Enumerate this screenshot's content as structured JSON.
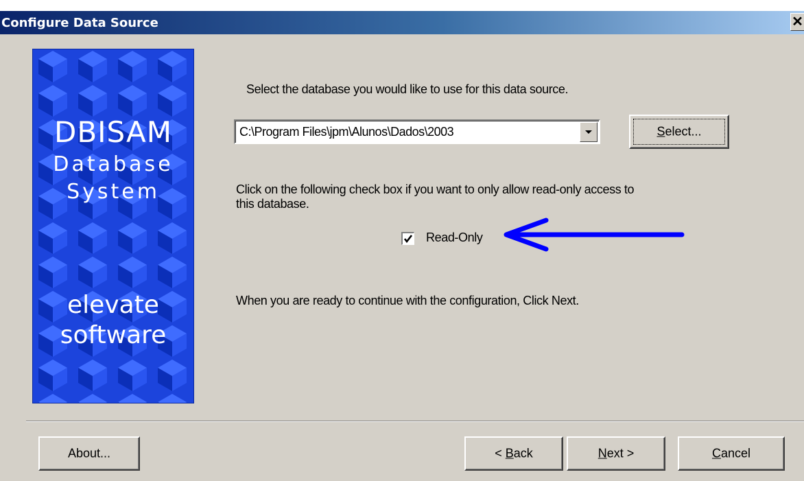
{
  "window": {
    "title": "Configure Data Source"
  },
  "banner": {
    "line1": "DBISAM",
    "line2": "Database",
    "line3": "System",
    "line4": "elevate",
    "line5": "software"
  },
  "instructions": {
    "select_db": "Select the database you would like to use for this data source.",
    "readonly_line1": "Click on the following check box if you want to only allow read-only access to",
    "readonly_line2": "this database.",
    "continue": "When you are ready to continue with the configuration, Click Next."
  },
  "database_combo": {
    "value": "C:\\Program Files\\jpm\\Alunos\\Dados\\2003"
  },
  "select_button": {
    "mnemonic": "S",
    "rest": "elect..."
  },
  "readonly_checkbox": {
    "label": "Read-Only",
    "checked": true
  },
  "footer": {
    "about": "About...",
    "back_prefix": "< ",
    "back_mnemonic": "B",
    "back_rest": "ack",
    "next_mnemonic": "N",
    "next_rest": "ext >",
    "cancel_mnemonic": "C",
    "cancel_rest": "ancel"
  },
  "colors": {
    "banner_blue": "#1a40d8",
    "dialog_bg": "#d4d0c8",
    "annotation_arrow": "#0000ff"
  }
}
